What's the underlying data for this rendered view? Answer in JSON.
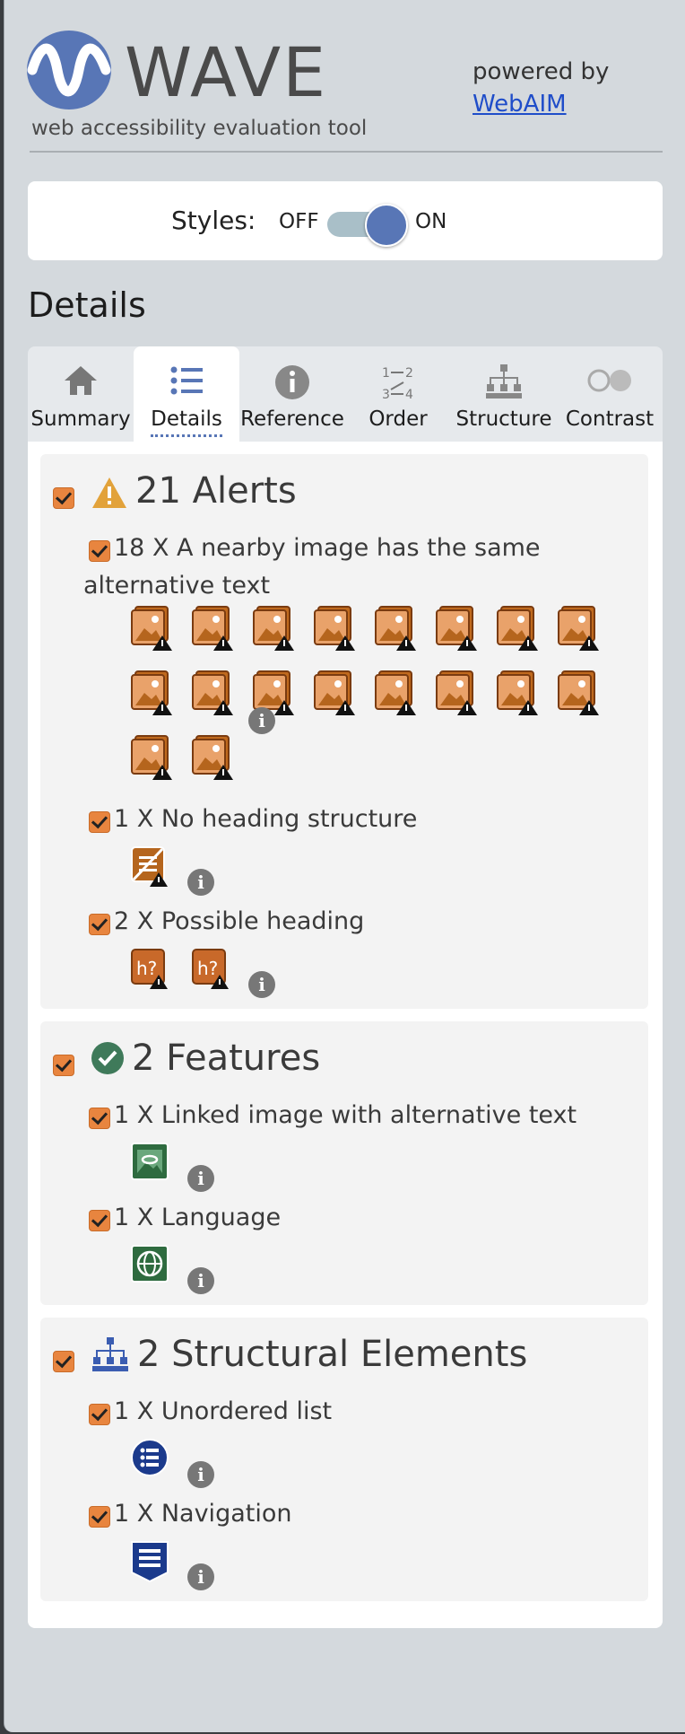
{
  "header": {
    "brand": "WAVE",
    "tagline": "web accessibility evaluation tool",
    "powered_by": "powered by",
    "webaim_link": "WebAIM"
  },
  "styles": {
    "label": "Styles:",
    "off": "OFF",
    "on": "ON",
    "state": "on"
  },
  "details_title": "Details",
  "tabs": [
    {
      "label": "Summary",
      "icon": "home-icon"
    },
    {
      "label": "Details",
      "icon": "list-icon",
      "active": true
    },
    {
      "label": "Reference",
      "icon": "info-icon"
    },
    {
      "label": "Order",
      "icon": "order-icon"
    },
    {
      "label": "Structure",
      "icon": "structure-icon"
    },
    {
      "label": "Contrast",
      "icon": "contrast-icon"
    }
  ],
  "sections": {
    "alerts": {
      "title": "21 Alerts",
      "items": [
        {
          "line1": "18 X A nearby image has the same",
          "line2": "alternative text",
          "count": 18
        },
        {
          "text": "1 X No heading structure",
          "count": 1
        },
        {
          "text": "2 X Possible heading",
          "count": 2
        }
      ]
    },
    "features": {
      "title": "2 Features",
      "items": [
        {
          "text": "1 X Linked image with alternative text"
        },
        {
          "text": "1 X Language"
        }
      ]
    },
    "structure": {
      "title": "2 Structural Elements",
      "items": [
        {
          "text": "1 X Unordered list"
        },
        {
          "text": "1 X Navigation"
        }
      ]
    }
  },
  "colors": {
    "brand_blue": "#5876b6",
    "alert_orange": "#e8853f",
    "feature_green": "#2e6b3f",
    "structure_blue": "#1b3a8c"
  }
}
